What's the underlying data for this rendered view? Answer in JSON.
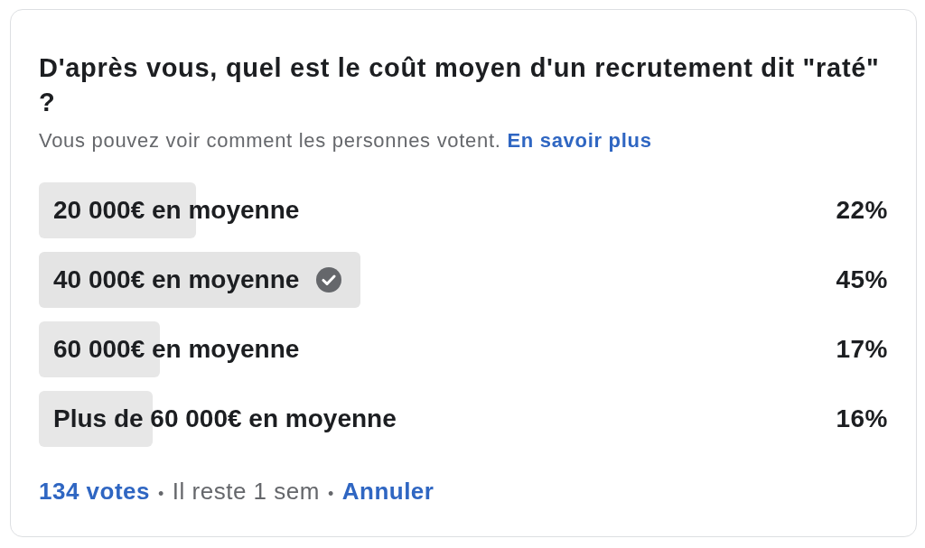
{
  "poll": {
    "question": "D'après vous, quel est le coût moyen d'un recrutement dit \"raté\" ?",
    "visibility_note": "Vous pouvez voir comment les personnes votent.",
    "learn_more_link": "En savoir plus",
    "options": [
      {
        "label": "20 000€ en moyenne",
        "percent": "22%",
        "level": 0.22,
        "selected": false
      },
      {
        "label": "40 000€ en moyenne",
        "percent": "45%",
        "level": 0.45,
        "selected": true
      },
      {
        "label": "60 000€ en moyenne",
        "percent": "17%",
        "level": 0.17,
        "selected": false
      },
      {
        "label": "Plus de 60 000€ en moyenne",
        "percent": "16%",
        "level": 0.16,
        "selected": false
      }
    ],
    "footer": [
      {
        "kind": "link",
        "text": "134 votes"
      },
      {
        "kind": "separator",
        "text": "•"
      },
      {
        "kind": "text",
        "text": "Il reste 1 sem"
      },
      {
        "kind": "separator",
        "text": "•"
      },
      {
        "kind": "link",
        "text": "Annuler"
      }
    ]
  }
}
